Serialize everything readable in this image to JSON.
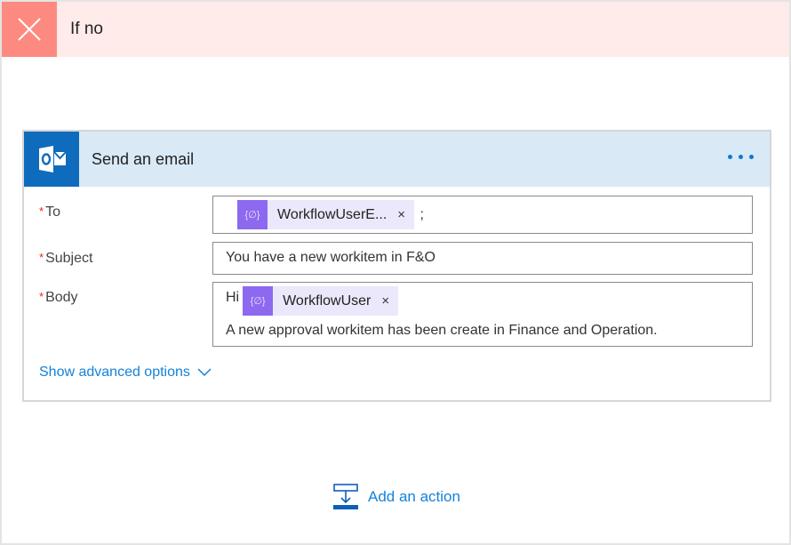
{
  "branch": {
    "title": "If no",
    "icon": "close-x-icon",
    "colors": {
      "header_bg": "#ffebea",
      "icon_bg": "#fd8a80"
    }
  },
  "action_card": {
    "title": "Send an email",
    "icon": "outlook-icon",
    "menu_icon": "more-options-icon",
    "colors": {
      "header_bg": "#d9e9f6",
      "icon_bg": "#0f6cbd",
      "accent": "#0f78d4"
    },
    "fields": {
      "to": {
        "label": "To",
        "required_mark": "*",
        "token": {
          "label": "WorkflowUserE...",
          "icon": "dynamic-content-icon",
          "remove": "×"
        },
        "trailing_text": ";"
      },
      "subject": {
        "label": "Subject",
        "required_mark": "*",
        "value": "You have a new workitem in F&O"
      },
      "body": {
        "label": "Body",
        "required_mark": "*",
        "prefix_text": "Hi",
        "token": {
          "label": "WorkflowUser",
          "icon": "dynamic-content-icon",
          "remove": "×"
        },
        "line2": "A new approval workitem has been create in Finance and Operation."
      }
    },
    "advanced_options_label": "Show advanced options"
  },
  "add_action": {
    "label": "Add an action",
    "icon": "add-action-icon"
  }
}
